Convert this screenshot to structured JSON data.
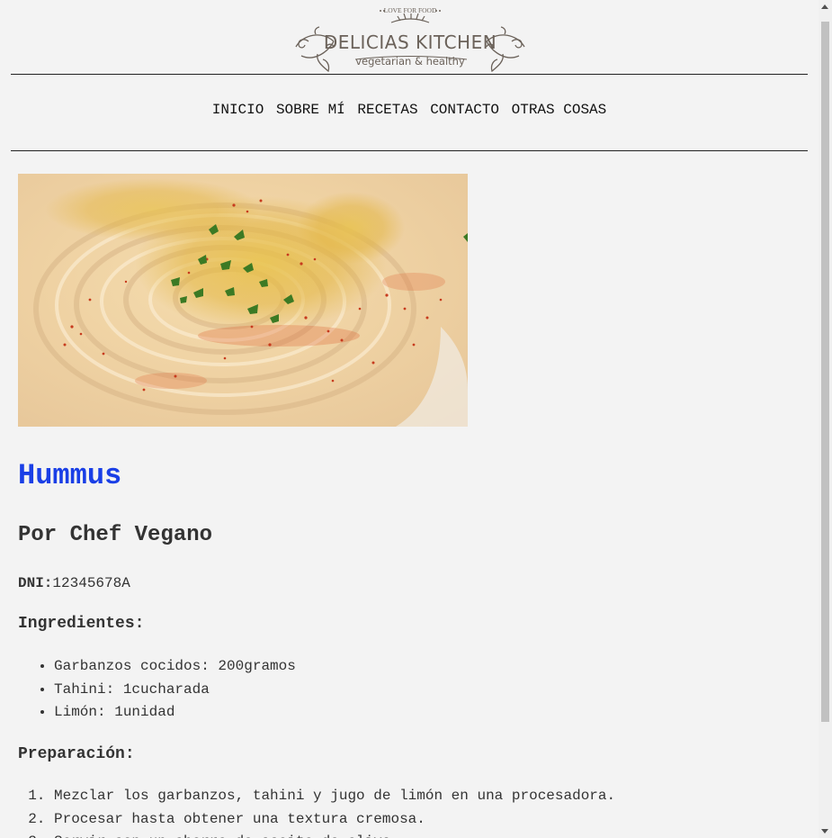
{
  "logo": {
    "tagline_top": "LOVE FOR FOOD",
    "brand": "DELICIAS KITCHEN",
    "tagline_bottom": "vegetarian & healthy"
  },
  "nav": {
    "items": [
      "INICIO",
      "SOBRE MÍ",
      "RECETAS",
      "CONTACTO",
      "OTRAS COSAS"
    ]
  },
  "hero": {
    "alt": "Hummus"
  },
  "recipe": {
    "title": "Hummus",
    "author": "Por Chef Vegano",
    "dni_label": "DNI:",
    "dni_value": "12345678A",
    "ingredients_label": "Ingredientes:",
    "ingredients": [
      "Garbanzos cocidos: 200gramos",
      "Tahini: 1cucharada",
      "Limón: 1unidad"
    ],
    "preparation_label": "Preparación:",
    "steps": [
      "Mezclar los garbanzos, tahini y jugo de limón en una procesadora.",
      "Procesar hasta obtener una textura cremosa.",
      "Servir con un chorro de aceite de oliva."
    ]
  },
  "colors": {
    "background": "#f3f3f3",
    "title": "#1a3fe6",
    "text": "#333333",
    "logo": "#6b625a"
  }
}
